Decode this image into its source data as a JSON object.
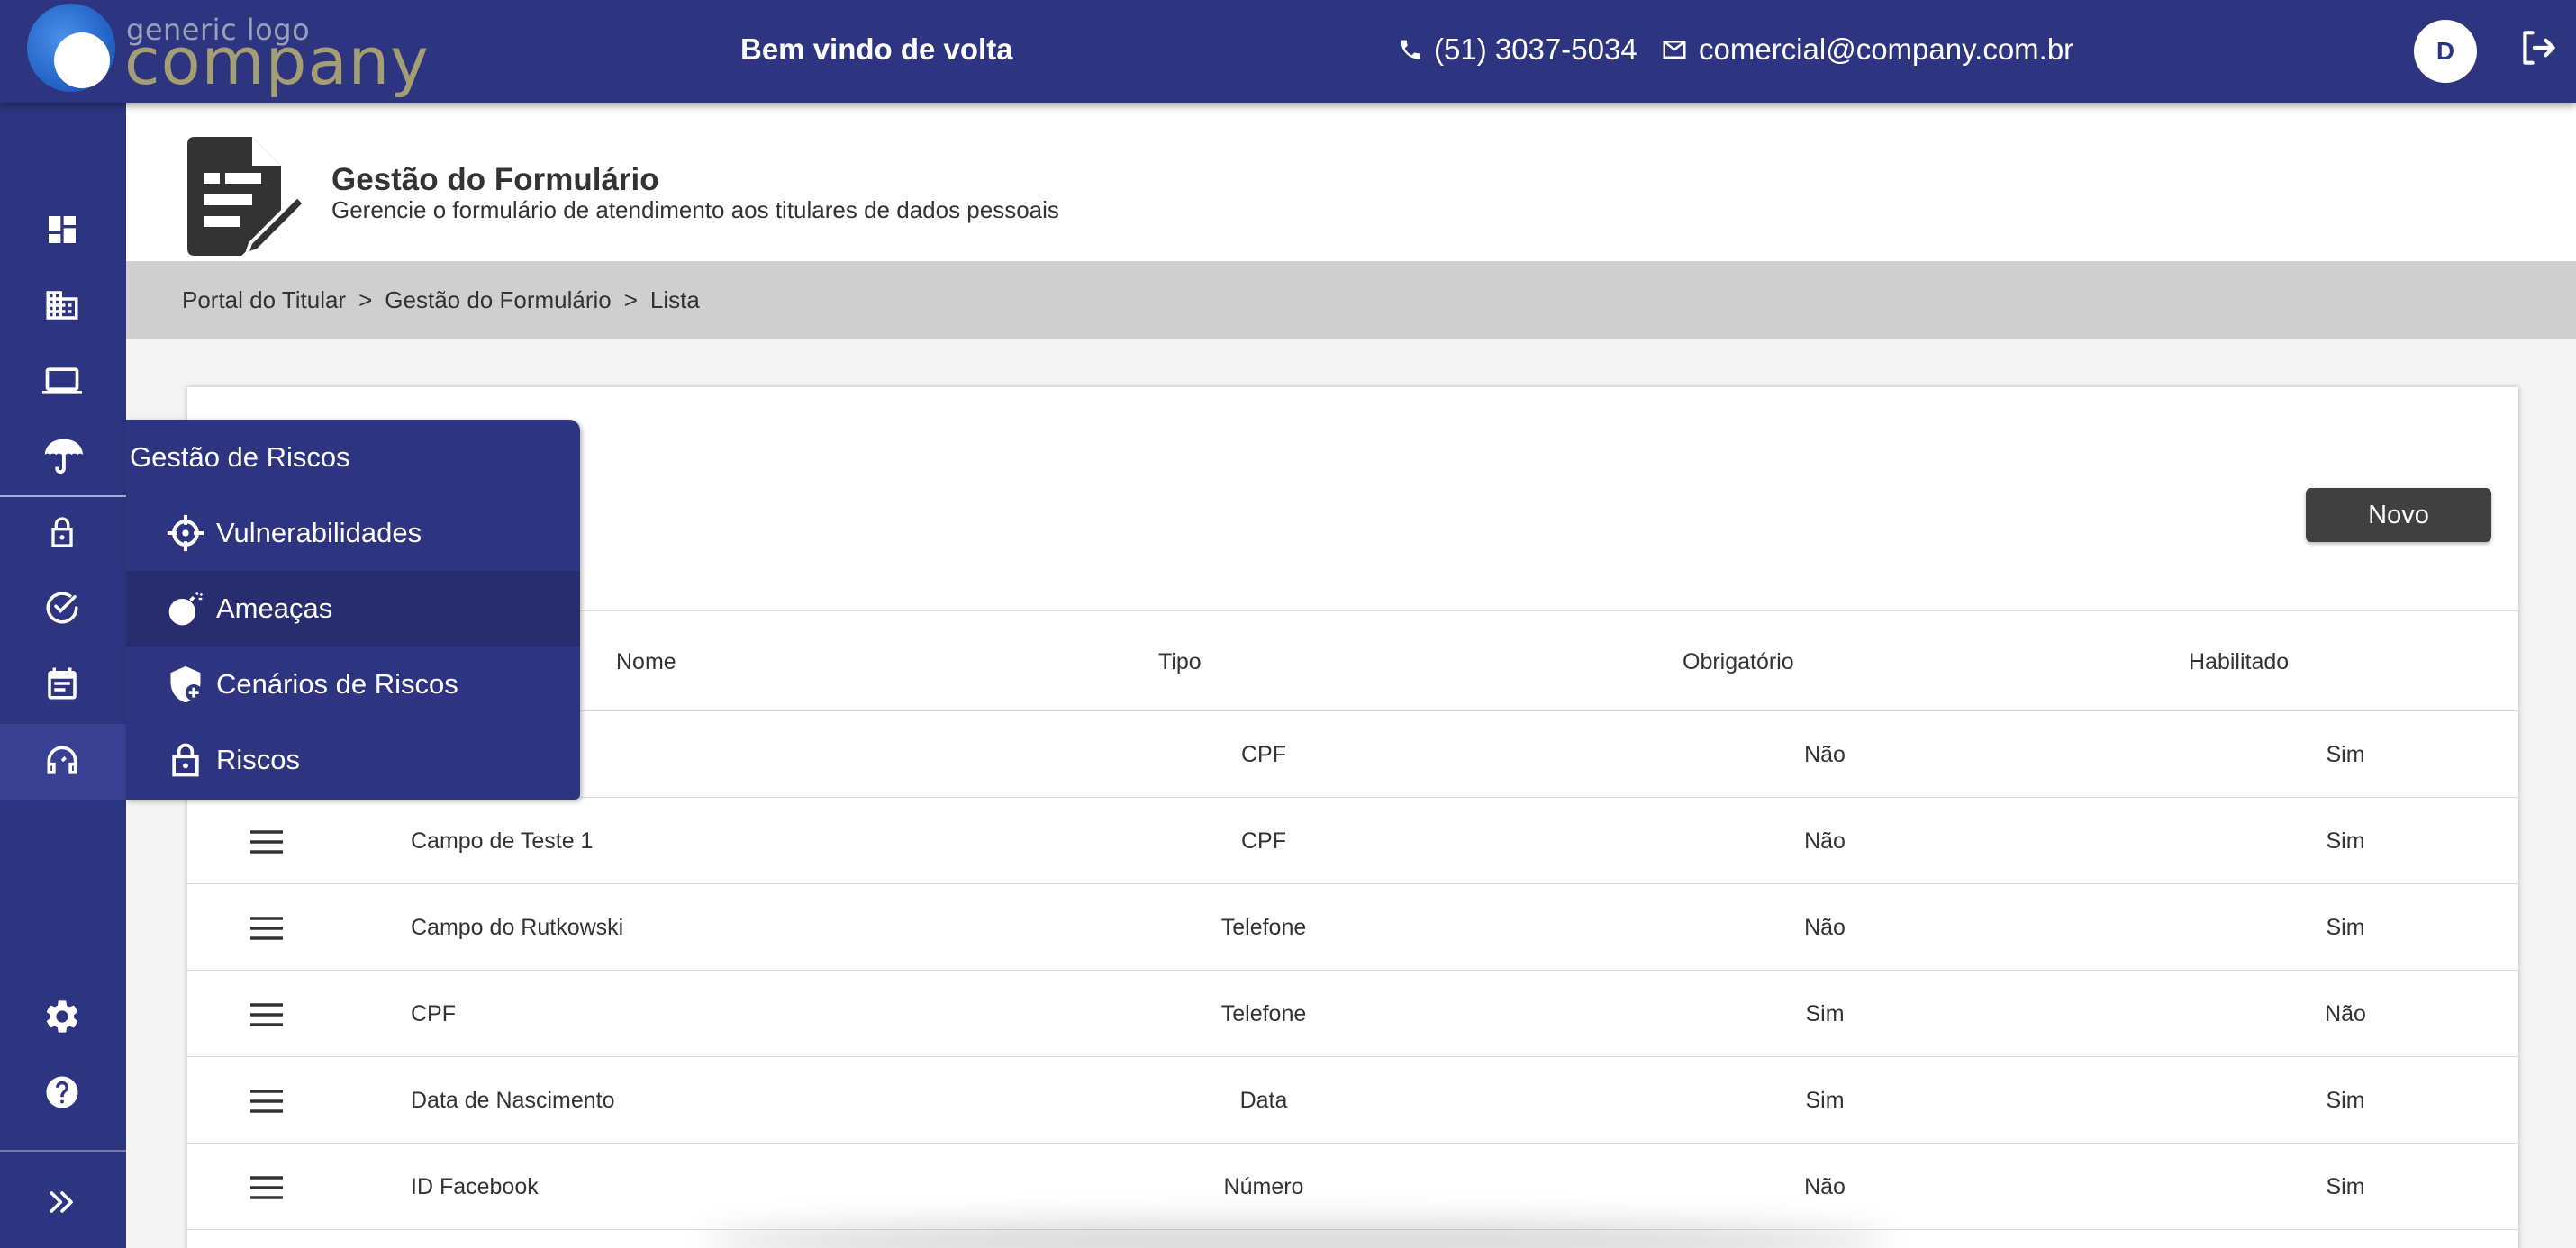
{
  "header": {
    "logo_small": "generic logo",
    "logo_big": "company",
    "welcome": "Bem vindo de volta",
    "phone": "(51) 3037-5034",
    "email": "comercial@company.com.br",
    "avatar_initial": "D"
  },
  "sidebar": {
    "items": [
      "dashboard-icon",
      "building-icon",
      "laptop-icon",
      "umbrella-icon",
      "lock-icon",
      "check-circle-icon",
      "calendar-icon",
      "headset-icon",
      "gear-icon",
      "help-icon",
      "expand-icon"
    ]
  },
  "page": {
    "title": "Gestão do Formulário",
    "subtitle": "Gerencie o formulário de atendimento aos titulares de dados pessoais"
  },
  "breadcrumb": {
    "items": [
      "Portal do Titular",
      "Gestão do Formulário",
      "Lista"
    ],
    "separator": ">"
  },
  "toolbar": {
    "new_label": "Novo"
  },
  "table": {
    "headers": {
      "name": "Nome",
      "type": "Tipo",
      "required": "Obrigatório",
      "enabled": "Habilitado"
    },
    "rows": [
      {
        "name": "",
        "type": "CPF",
        "required": "Não",
        "enabled": "Sim"
      },
      {
        "name": "Campo de Teste 1",
        "type": "CPF",
        "required": "Não",
        "enabled": "Sim"
      },
      {
        "name": "Campo do Rutkowski",
        "type": "Telefone",
        "required": "Não",
        "enabled": "Sim"
      },
      {
        "name": "CPF",
        "type": "Telefone",
        "required": "Sim",
        "enabled": "Não"
      },
      {
        "name": "Data de Nascimento",
        "type": "Data",
        "required": "Sim",
        "enabled": "Sim"
      },
      {
        "name": "ID Facebook",
        "type": "Número",
        "required": "Não",
        "enabled": "Sim"
      }
    ]
  },
  "flyout": {
    "title": "Gestão de Riscos",
    "items": [
      {
        "label": "Vulnerabilidades",
        "icon": "crosshair-icon"
      },
      {
        "label": "Ameaças",
        "icon": "bomb-icon"
      },
      {
        "label": "Cenários de Riscos",
        "icon": "shield-plus-icon"
      },
      {
        "label": "Riscos",
        "icon": "lock-icon"
      }
    ]
  },
  "colors": {
    "primary": "#2e3580",
    "button": "#404040",
    "breadcrumb_bg": "#cfcfcf"
  }
}
